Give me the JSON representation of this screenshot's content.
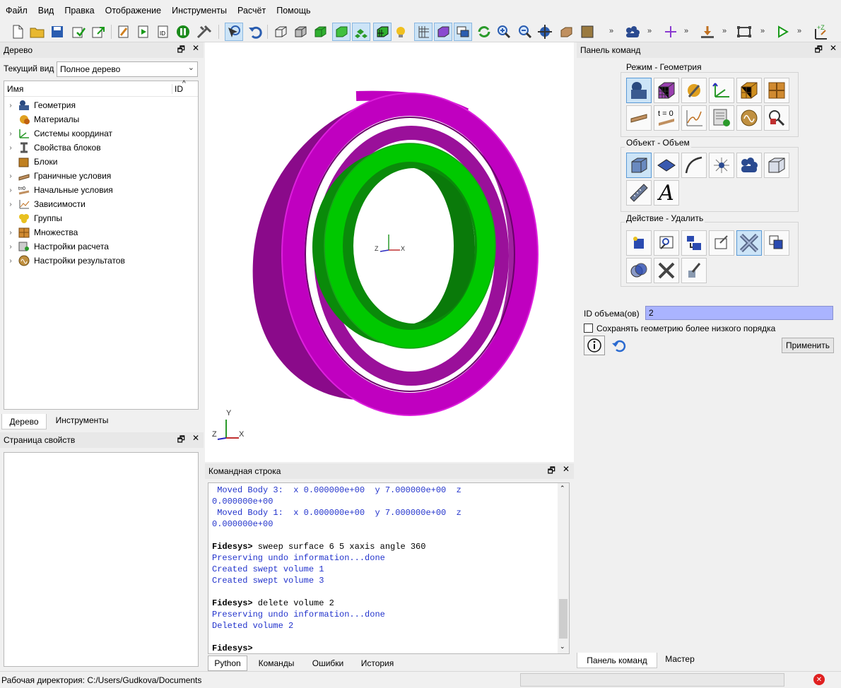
{
  "menu": [
    "Файл",
    "Вид",
    "Правка",
    "Отображение",
    "Инструменты",
    "Расчёт",
    "Помощь"
  ],
  "tree_panel": {
    "title": "Дерево",
    "current_view_label": "Текущий вид",
    "current_view_value": "Полное дерево",
    "col_name": "Имя",
    "col_id": "ID",
    "items": [
      "Геометрия",
      "Материалы",
      "Системы координат",
      "Свойства блоков",
      "Блоки",
      "Граничные условия",
      "Начальные условия",
      "Зависимости",
      "Группы",
      "Множества",
      "Настройки расчета",
      "Настройки результатов"
    ],
    "tabs": [
      "Дерево",
      "Инструменты"
    ]
  },
  "props_panel": {
    "title": "Страница свойств"
  },
  "viewport": {
    "axis_x": "X",
    "axis_y": "Y",
    "axis_z": "Z"
  },
  "cmd_panel": {
    "title": "Командная строка",
    "lines": [
      {
        "t": " Moved Body 3:  x 0.000000e+00  y 7.000000e+00  z",
        "c": "blue"
      },
      {
        "t": "0.000000e+00",
        "c": "blue"
      },
      {
        "t": " Moved Body 1:  x 0.000000e+00  y 7.000000e+00  z",
        "c": "blue"
      },
      {
        "t": "0.000000e+00",
        "c": "blue"
      },
      {
        "t": "",
        "c": "blue"
      },
      {
        "t": "Fidesys>",
        "c": "bold",
        "rest": " sweep surface 6 5 xaxis angle 360"
      },
      {
        "t": "Preserving undo information...done",
        "c": "blue"
      },
      {
        "t": "Created swept volume 1",
        "c": "blue"
      },
      {
        "t": "Created swept volume 3",
        "c": "blue"
      },
      {
        "t": "",
        "c": "blue"
      },
      {
        "t": "Fidesys>",
        "c": "bold",
        "rest": " delete volume 2"
      },
      {
        "t": "Preserving undo information...done",
        "c": "blue"
      },
      {
        "t": "Deleted volume 2",
        "c": "blue"
      },
      {
        "t": "",
        "c": "blue"
      },
      {
        "t": "Fidesys>",
        "c": "bold",
        "rest": ""
      }
    ],
    "tabs": [
      "Python",
      "Команды",
      "Ошибки",
      "История"
    ]
  },
  "command_panel": {
    "title": "Панель команд",
    "mode_label": "Режим - Геометрия",
    "object_label": "Объект - Объем",
    "action_label": "Действие - Удалить",
    "t0_label": "t = 0",
    "font_a": "A",
    "volume_id_label": "ID объема(ов)",
    "volume_id_value": "2",
    "keep_lower_order_label": "Сохранять геометрию более низкого порядка",
    "apply_label": "Применить",
    "tabs": [
      "Панель команд",
      "Мастер"
    ]
  },
  "status": {
    "workdir": "Рабочая директория: C:/Users/Gudkova/Documents"
  },
  "colors": {
    "magenta": "#b000b0",
    "green": "#00c000",
    "selection": "#aab4ff"
  }
}
